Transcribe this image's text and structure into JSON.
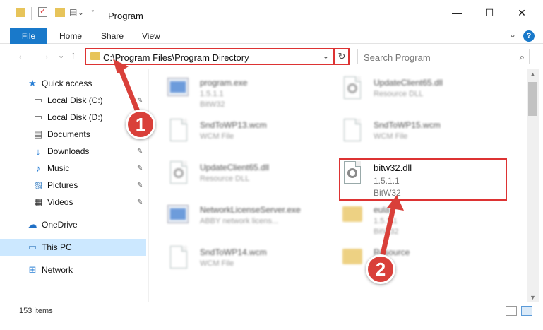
{
  "window": {
    "title": "Program",
    "minimize_glyph": "—",
    "maximize_glyph": "☐",
    "close_glyph": "✕"
  },
  "ribbon": {
    "file": "File",
    "home": "Home",
    "share": "Share",
    "view": "View",
    "help": "?",
    "expand_glyph": "⌄"
  },
  "address": {
    "path": "C:\\Program Files\\Program Directory",
    "dropdown_glyph": "⌄",
    "refresh_glyph": "↻"
  },
  "search": {
    "placeholder": "Search Program",
    "icon": "search-icon"
  },
  "nav": {
    "back": "←",
    "forward": "→",
    "recent": "⌄",
    "up": "↑"
  },
  "sidebar": {
    "items": [
      {
        "label": "Quick access",
        "icon": "star-icon",
        "glyph": "★",
        "color": "#2a7fd5"
      },
      {
        "label": "Local Disk (C:)",
        "icon": "drive-icon",
        "glyph": "▭",
        "color": "#555",
        "pinned": true
      },
      {
        "label": "Local Disk (D:)",
        "icon": "drive-icon",
        "glyph": "▭",
        "color": "#555"
      },
      {
        "label": "Documents",
        "icon": "documents-icon",
        "glyph": "▤",
        "color": "#666",
        "pinned": true
      },
      {
        "label": "Downloads",
        "icon": "downloads-icon",
        "glyph": "↓",
        "color": "#2a7fd5",
        "pinned": true
      },
      {
        "label": "Music",
        "icon": "music-icon",
        "glyph": "♪",
        "color": "#2a7fd5",
        "pinned": true
      },
      {
        "label": "Pictures",
        "icon": "pictures-icon",
        "glyph": "▨",
        "color": "#4a8ac8",
        "pinned": true
      },
      {
        "label": "Videos",
        "icon": "videos-icon",
        "glyph": "▦",
        "color": "#333",
        "pinned": true
      },
      {
        "label": "OneDrive",
        "icon": "cloud-icon",
        "glyph": "☁",
        "color": "#1f6fc5"
      },
      {
        "label": "This PC",
        "icon": "computer-icon",
        "glyph": "▭",
        "color": "#4a8ac8"
      },
      {
        "label": "Network",
        "icon": "network-icon",
        "glyph": "⊞",
        "color": "#2a7fd5"
      }
    ],
    "pin_glyph": "📌"
  },
  "files": [
    {
      "name": "program.exe",
      "line1": "1.5.1.1",
      "line2": "BitW32"
    },
    {
      "name": "UpdateClient65.dll",
      "line1": "Resource DLL",
      "line2": ""
    },
    {
      "name": "SndToWP13.wcm",
      "line1": "WCM File",
      "line2": ""
    },
    {
      "name": "SndToWP15.wcm",
      "line1": "WCM File",
      "line2": ""
    },
    {
      "name": "UpdateClient65.dll",
      "line1": "Resource DLL",
      "line2": ""
    },
    {
      "name": "bitw32.dll",
      "line1": "1.5.1.1",
      "line2": "BitW32"
    },
    {
      "name": "NetworkLicenseServer.exe",
      "line1": "ABBY network licens...",
      "line2": ""
    },
    {
      "name": "eula",
      "line1": "1.5.1.1",
      "line2": "BitW32"
    },
    {
      "name": "SndToWP14.wcm",
      "line1": "WCM File",
      "line2": ""
    },
    {
      "name": "Resource",
      "line1": "",
      "line2": ""
    }
  ],
  "status": {
    "item_count": "153 items"
  },
  "annotations": {
    "step1": "1",
    "step2": "2",
    "color": "#d9403a"
  }
}
